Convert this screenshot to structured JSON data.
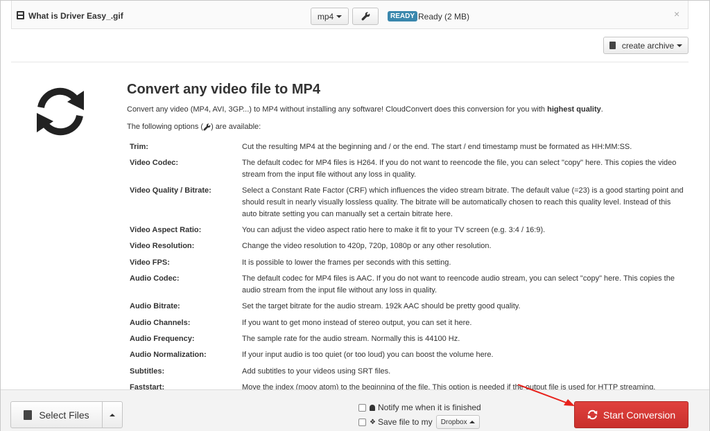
{
  "file": {
    "name": "What is Driver Easy_.gif",
    "format": "mp4",
    "status_badge": "READY",
    "status_text": "Ready (2 MB)",
    "close_symbol": "×"
  },
  "archive_button": {
    "label": "create archive"
  },
  "main": {
    "title": "Convert any video file to MP4",
    "intro_prefix": "Convert any  video (MP4, AVI, 3GP...) to MP4 without installing any software! CloudConvert does this conversion for you with ",
    "intro_bold": "highest quality",
    "intro_suffix": ".",
    "options_intro_prefix": "The following options (",
    "options_intro_suffix": ") are available:"
  },
  "options": [
    {
      "label": "Trim:",
      "desc": "Cut the resulting MP4 at the beginning and / or the end. The start / end timestamp must be formated as HH:MM:SS."
    },
    {
      "label": "Video Codec:",
      "desc": "The default codec for MP4 files is H264. If you do not want to reencode the file, you can select \"copy\" here. This copies the video stream from the input file without any loss in quality."
    },
    {
      "label": "Video Quality / Bitrate:",
      "desc": "Select a Constant Rate Factor (CRF) which influences the video stream bitrate. The default value (=23) is a good starting point and should result in nearly visually lossless quality. The bitrate will be automatically chosen to reach this quality level. Instead of this auto bitrate setting you can manually set a certain bitrate here."
    },
    {
      "label": "Video Aspect Ratio:",
      "desc": "You can adjust the video aspect ratio here to make it fit to your TV screen (e.g. 3:4 / 16:9)."
    },
    {
      "label": "Video Resolution:",
      "desc": "Change the video resolution to 420p, 720p, 1080p or any other resolution."
    },
    {
      "label": "Video FPS:",
      "desc": "It is possible to lower the frames per seconds with this setting."
    },
    {
      "label": "Audio Codec:",
      "desc": "The default codec for MP4 files is AAC. If you do not want to reencode audio stream, you can select \"copy\" here. This copies the audio stream from the input file without any loss in quality."
    },
    {
      "label": "Audio Bitrate:",
      "desc": "Set the target bitrate for the audio stream. 192k AAC should be pretty good quality."
    },
    {
      "label": "Audio Channels:",
      "desc": "If you want to get mono instead of stereo output, you can set it here."
    },
    {
      "label": "Audio Frequency:",
      "desc": "The sample rate for the audio stream. Normally this is 44100 Hz."
    },
    {
      "label": "Audio Normalization:",
      "desc": "If your input audio is too quiet (or too loud) you can boost the volume here."
    },
    {
      "label": "Subtitles:",
      "desc": "Add subtitles to your videos using SRT files."
    },
    {
      "label": "Faststart:",
      "desc": "Move the index (moov atom) to the beginning of the file. This option is needed if the output file is used for HTTP streaming."
    }
  ],
  "bottom": {
    "select_files": "Select Files",
    "notify_label": "Notify me when it is finished",
    "save_label": "Save file to my",
    "dropbox_label": "Dropbox",
    "start_label": "Start Conversion"
  },
  "colors": {
    "start_button": "#d9534f",
    "ready_badge": "#3a87ad",
    "annotation_arrow": "#e8221c"
  },
  "icons": {
    "file": "film-icon",
    "settings": "wrench-icon",
    "convert": "refresh-icon",
    "archive": "archive-icon",
    "upload": "file-upload-icon",
    "notify": "bell-icon",
    "cloud": "dropbox-icon"
  }
}
